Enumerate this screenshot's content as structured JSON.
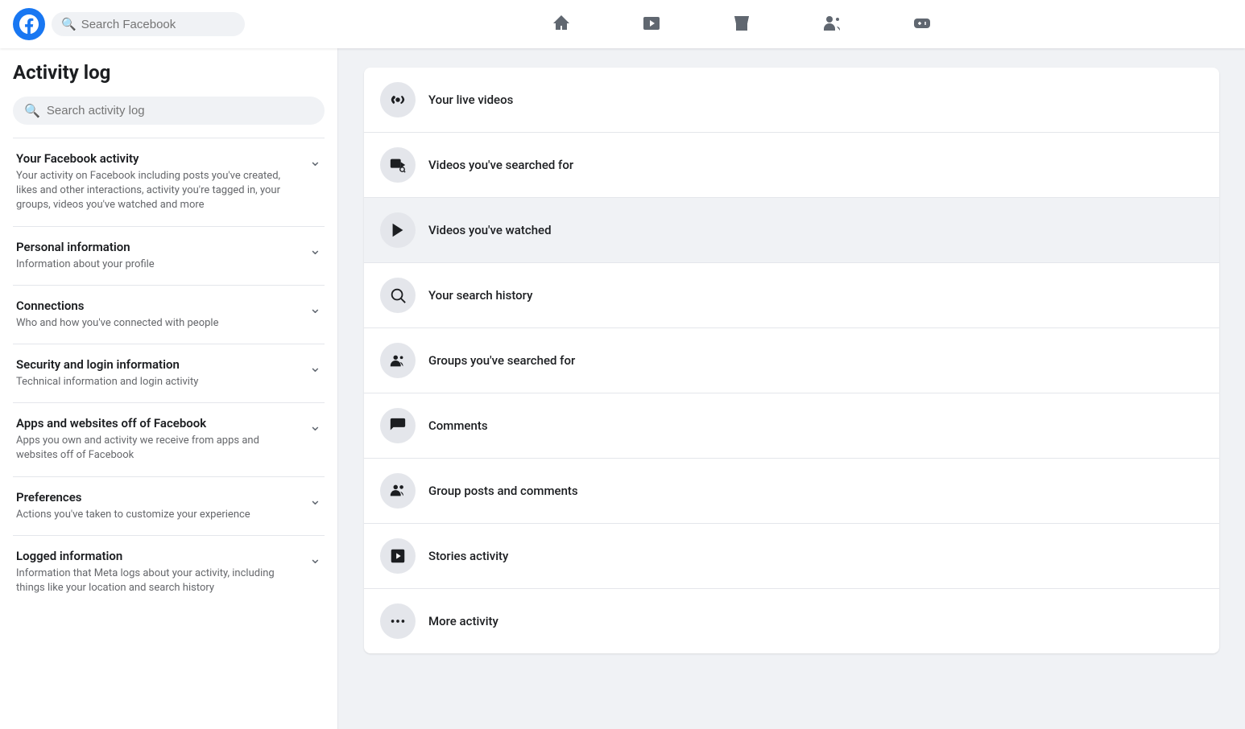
{
  "topnav": {
    "search_placeholder": "Search Facebook",
    "logo_label": "Facebook"
  },
  "nav_icons": [
    {
      "name": "home-icon",
      "label": "Home"
    },
    {
      "name": "watch-icon",
      "label": "Watch"
    },
    {
      "name": "marketplace-icon",
      "label": "Marketplace"
    },
    {
      "name": "friends-icon",
      "label": "Friends"
    },
    {
      "name": "gaming-icon",
      "label": "Gaming"
    }
  ],
  "sidebar": {
    "title": "Activity log",
    "search_placeholder": "Search activity log",
    "sections": [
      {
        "title": "Your Facebook activity",
        "desc": "Your activity on Facebook including posts you've created, likes and other interactions, activity you're tagged in, your groups, videos you've watched and more",
        "expanded": true
      },
      {
        "title": "Personal information",
        "desc": "Information about your profile",
        "expanded": false
      },
      {
        "title": "Connections",
        "desc": "Who and how you've connected with people",
        "expanded": false
      },
      {
        "title": "Security and login information",
        "desc": "Technical information and login activity",
        "expanded": false
      },
      {
        "title": "Apps and websites off of Facebook",
        "desc": "Apps you own and activity we receive from apps and websites off of Facebook",
        "expanded": false
      },
      {
        "title": "Preferences",
        "desc": "Actions you've taken to customize your experience",
        "expanded": false
      },
      {
        "title": "Logged information",
        "desc": "Information that Meta logs about your activity, including things like your location and search history",
        "expanded": false
      }
    ]
  },
  "content": {
    "items": [
      {
        "label": "Your live videos",
        "icon": "live-video-icon"
      },
      {
        "label": "Videos you've searched for",
        "icon": "video-search-icon"
      },
      {
        "label": "Videos you've watched",
        "icon": "video-watched-icon",
        "active": true
      },
      {
        "label": "Your search history",
        "icon": "search-history-icon"
      },
      {
        "label": "Groups you've searched for",
        "icon": "groups-search-icon"
      },
      {
        "label": "Comments",
        "icon": "comments-icon"
      },
      {
        "label": "Group posts and comments",
        "icon": "group-posts-icon"
      },
      {
        "label": "Stories activity",
        "icon": "stories-icon"
      },
      {
        "label": "More activity",
        "icon": "more-icon"
      }
    ]
  }
}
